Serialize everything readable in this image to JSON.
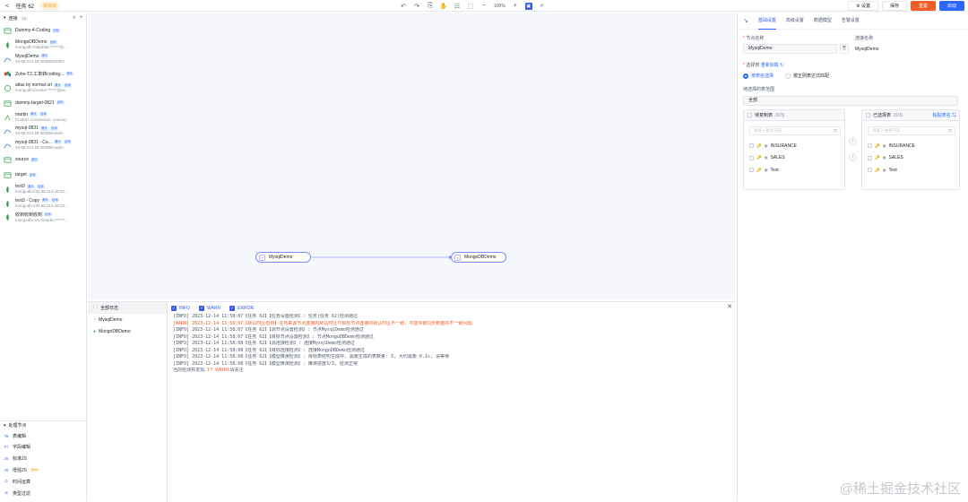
{
  "header": {
    "back": "<",
    "title": "任务 62",
    "status": "将启动",
    "zoom": "100%",
    "buttons": {
      "settings": "设置",
      "save": "保存",
      "reset": "重置",
      "start": "启动"
    }
  },
  "sidebar": {
    "title": "连接",
    "count": "16",
    "items": [
      {
        "name": "Dummy-4-Coding",
        "tags": [
          "目标"
        ],
        "sub": "",
        "icon": "dummy"
      },
      {
        "name": "MongoDBDemo",
        "tags": [
          "目标"
        ],
        "sub": "mongodb://tapdata:******@...",
        "icon": "mongo"
      },
      {
        "name": "MysqlDemo",
        "tags": [
          "源头"
        ],
        "sub": "34.96.213.48:30306/DEMO",
        "icon": "mysql"
      },
      {
        "name": "Zoho-T2.工单转coding...",
        "tags": [
          "源头"
        ],
        "sub": "",
        "icon": "zoho"
      },
      {
        "name": "atlas by normal url",
        "tags": [
          "源头",
          "目标"
        ],
        "sub": "mongodb://martin:******@ac...",
        "icon": "atlas"
      },
      {
        "name": "dummy-target-0821",
        "tags": [
          "目标"
        ],
        "sub": "",
        "icon": "dummy"
      },
      {
        "name": "martin",
        "tags": [
          "源头",
          "目标"
        ],
        "sub": "Custom Connection: source(...",
        "icon": "custom"
      },
      {
        "name": "mysql-0831",
        "tags": [
          "源头",
          "目标"
        ],
        "sub": "34.96.213.48:30306/martin",
        "icon": "mysql"
      },
      {
        "name": "mysql-0831 - Co...",
        "tags": [
          "源头",
          "目标"
        ],
        "sub": "34.96.213.48:30306/martin",
        "icon": "mysql"
      },
      {
        "name": "source",
        "tags": [
          "源头"
        ],
        "sub": "",
        "icon": "dummy"
      },
      {
        "name": "target",
        "tags": [
          "目标"
        ],
        "sub": "",
        "icon": "dummy"
      },
      {
        "name": "test3",
        "tags": [
          "源头",
          "目标"
        ],
        "sub": "mongodb://34.96.213.48:32...",
        "icon": "mongo"
      },
      {
        "name": "test3 - Copy",
        "tags": [
          "源头",
          "目标"
        ],
        "sub": "mongodb://34.96.213.48:32...",
        "icon": "mongo"
      },
      {
        "name": "收到收到收到",
        "tags": [
          "目标"
        ],
        "sub": "mongodb+srv://martin:******...",
        "icon": "mongo"
      }
    ],
    "processing_title": "处理节点",
    "processing": [
      {
        "icon": "Ta",
        "label": "表编辑",
        "beta": ""
      },
      {
        "icon": "Fi",
        "label": "字段编辑",
        "beta": ""
      },
      {
        "icon": "JS",
        "label": "标准JS",
        "beta": ""
      },
      {
        "icon": "JS",
        "label": "增强JS",
        "beta": "Beta"
      },
      {
        "icon": "⊙",
        "label": "时间运算",
        "beta": ""
      },
      {
        "icon": "⊘",
        "label": "类型过滤",
        "beta": ""
      }
    ]
  },
  "canvas": {
    "nodes": [
      {
        "label": "MysqlDemo"
      },
      {
        "label": "MongoDBDemo"
      }
    ]
  },
  "logs": {
    "side": [
      {
        "label": "全部日志"
      },
      {
        "label": "MysqlDemo"
      },
      {
        "label": "MongoDBDemo"
      }
    ],
    "filters": [
      "INFO",
      "WARN",
      "ERROR"
    ],
    "lines": [
      {
        "text": "[INFO] 2023-12-14 11:58:07【任务 62】【任务设置检测】: 任务(任务 62)检测通过",
        "level": "info"
      },
      {
        "text": "[WARN] 2023-12-14 11:58:07【默认时区检测】任务来源节点连接的默认时区与目标节点连接的默认时区不一致，可能导致同步数据的不一致问题。",
        "level": "warn"
      },
      {
        "text": "[INFO] 2023-12-14 11:58:07【任务 62】【源节点设置检测】: 节点MysqlDemo检测通过",
        "level": "info"
      },
      {
        "text": "[INFO] 2023-12-14 11:58:07【任务 62】【目标节点设置检测】: 节点MongoDBDemo检测通过",
        "level": "info"
      },
      {
        "text": "[INFO] 2023-12-14 11:58:08【任务 62】【源连接检测】: 连接MysqlDemo检测通过",
        "level": "info"
      },
      {
        "text": "[INFO] 2023-12-14 11:58:08【任务 62】【目标连接检测】: 连接MongoDBDemo检测通过",
        "level": "info"
      },
      {
        "text": "[INFO] 2023-12-14 11:58:08【任务 62】【模型推演检测】: 目标表结构生成中, 需要生成的表数量: 3, 大约需要 0.1s, 请等待",
        "level": "info"
      },
      {
        "text": "[INFO] 2023-12-14 11:58:08【任务 62】【模型推演检测】: 推演进度3/3, 检测正常",
        "level": "info"
      }
    ],
    "footer_prefix": "当前检测共发现,",
    "footer_count": "1个 WARN",
    "footer_suffix": "请关注"
  },
  "panel": {
    "tabs": [
      "基础设置",
      "高级设置",
      "数据模型",
      "告警设置"
    ],
    "node_name_label": "节点名称",
    "node_name_value": "MysqlDemo",
    "conn_name_label": "连接名称",
    "conn_name_value": "MysqlDemo",
    "select_table_label": "选择表",
    "reload": "重新加载",
    "radio_by_table": "按表名选择",
    "radio_by_regex": "按正则表达式匹配",
    "scope_label": "待选择的表范围",
    "scope_value": "全部",
    "left_box": {
      "title": "待复制表",
      "count": "(0/3)",
      "search": "请输入搜索内容...",
      "tables": [
        "INSURANCE",
        "SALES",
        "Test"
      ]
    },
    "right_box": {
      "title": "已选择表",
      "count": "(0/3)",
      "search": "请输入搜索内容...",
      "paste": "粘贴表名",
      "tables": [
        "INSURANCE",
        "SALES",
        "Test"
      ]
    }
  },
  "watermark": "@稀土掘金技术社区"
}
